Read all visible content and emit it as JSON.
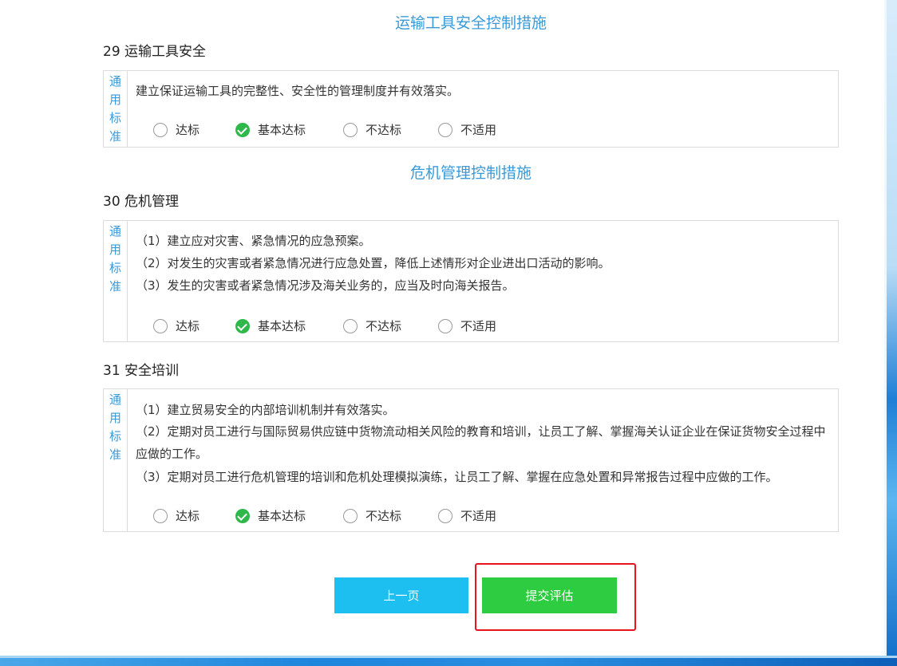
{
  "options": {
    "pass": "达标",
    "basic": "基本达标",
    "fail": "不达标",
    "na": "不适用"
  },
  "box_label": [
    "通",
    "用",
    "标",
    "准"
  ],
  "sections": [
    {
      "heading": "运输工具安全控制措施",
      "items": [
        {
          "title": "29 运输工具安全",
          "lines": [
            "建立保证运输工具的完整性、安全性的管理制度并有效落实。"
          ],
          "selected": "基本达标"
        }
      ]
    },
    {
      "heading": "危机管理控制措施",
      "items": [
        {
          "title": "30 危机管理",
          "lines": [
            "（1）建立应对灾害、紧急情况的应急预案。",
            "（2）对发生的灾害或者紧急情况进行应急处置，降低上述情形对企业进出口活动的影响。",
            "（3）发生的灾害或者紧急情况涉及海关业务的，应当及时向海关报告。"
          ],
          "selected": "基本达标"
        },
        {
          "title": "31 安全培训",
          "lines": [
            "（1）建立贸易安全的内部培训机制并有效落实。",
            "（2）定期对员工进行与国际贸易供应链中货物流动相关风险的教育和培训，让员工了解、掌握海关认证企业在保证货物安全过程中应做的工作。",
            "（3）定期对员工进行危机管理的培训和危机处理模拟演练，让员工了解、掌握在应急处置和异常报告过程中应做的工作。"
          ],
          "selected": "基本达标"
        }
      ]
    }
  ],
  "buttons": {
    "prev": "上一页",
    "submit": "提交评估"
  },
  "colors": {
    "heading": "#3a9ad9",
    "checked": "#2fb84a",
    "prev_button": "#1dbef0",
    "submit_button": "#2ecc40",
    "highlight_border": "#e8131c"
  }
}
